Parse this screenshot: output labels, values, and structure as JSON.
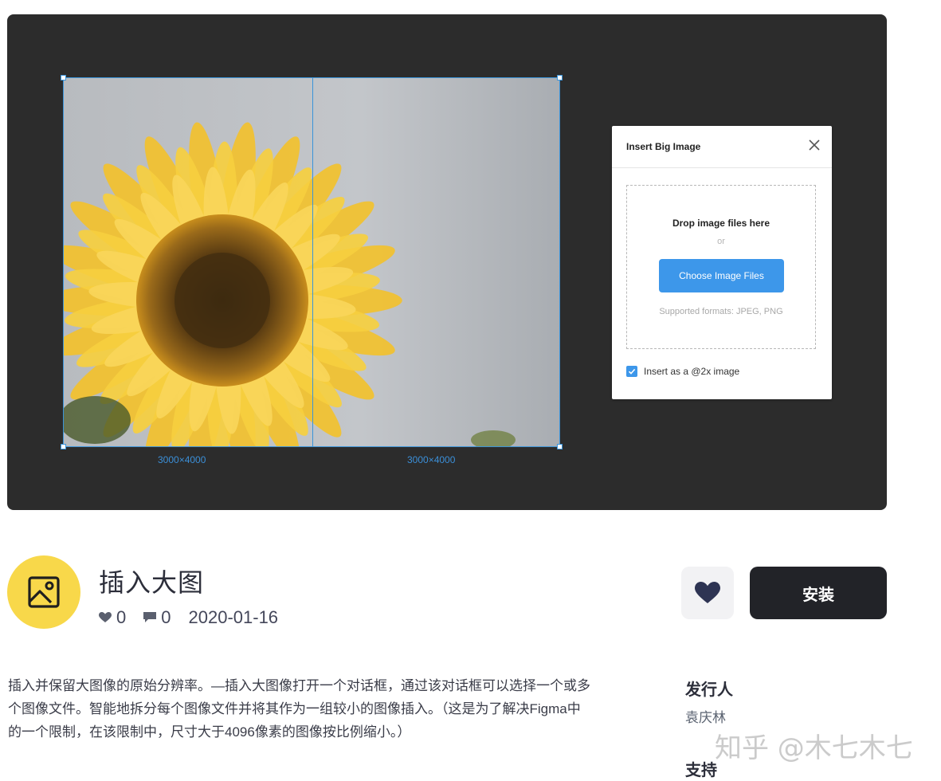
{
  "hero": {
    "left_dimension": "3000×4000",
    "right_dimension": "3000×4000",
    "dialog": {
      "title": "Insert Big Image",
      "drop_text": "Drop image files here",
      "or_text": "or",
      "choose_button": "Choose Image Files",
      "formats": "Supported formats: JPEG, PNG",
      "checkbox_label": "Insert as a @2x image",
      "checkbox_checked": true,
      "icons": {
        "close": "close-icon",
        "check": "check-icon"
      }
    }
  },
  "plugin": {
    "icon": "image-icon",
    "title": "插入大图",
    "likes": "0",
    "comments": "0",
    "date": "2020-01-16",
    "like_button_icon": "heart-icon",
    "install_label": "安装",
    "description": "插入并保留大图像的原始分辨率。—插入大图像打开一个对话框，通过该对话框可以选择一个或多个图像文件。智能地拆分每个图像文件并将其作为一组较小的图像插入。（这是为了解决Figma中的一个限制，在该限制中，尺寸大于4096像素的图像按比例缩小。）",
    "publisher_heading": "发行人",
    "publisher_name": "袁庆林",
    "support_heading": "支持"
  },
  "watermark": "知乎 @木七木七",
  "colors": {
    "accent": "#3d97ea",
    "icon_bg": "#f8d84a",
    "install_bg": "#222328",
    "hero_bg": "#2c2c2c"
  }
}
